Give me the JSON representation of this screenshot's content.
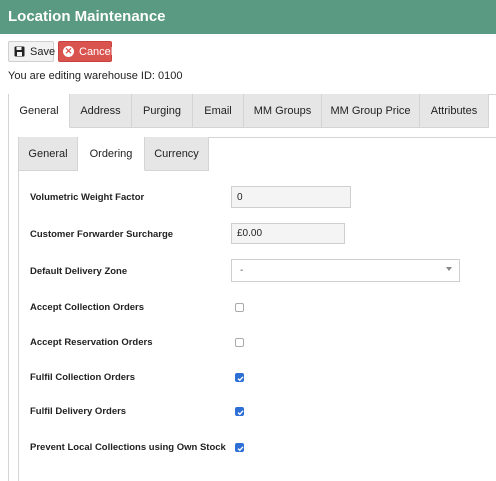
{
  "header": {
    "title": "Location Maintenance"
  },
  "toolbar": {
    "save_label": "Save",
    "save_icon": "floppy-disk-icon",
    "cancel_label": "Cancel",
    "cancel_icon": "close-circle-icon"
  },
  "editing_text": "You are editing warehouse ID: 0100",
  "outer_tabs": [
    {
      "label": "General",
      "active": true
    },
    {
      "label": "Address",
      "active": false
    },
    {
      "label": "Purging",
      "active": false
    },
    {
      "label": "Email",
      "active": false
    },
    {
      "label": "MM Groups",
      "active": false
    },
    {
      "label": "MM Group Price",
      "active": false
    },
    {
      "label": "Attributes",
      "active": false
    }
  ],
  "inner_tabs": [
    {
      "label": "General",
      "active": false
    },
    {
      "label": "Ordering",
      "active": true
    },
    {
      "label": "Currency",
      "active": false
    }
  ],
  "form": {
    "volumetric_weight_factor": {
      "label": "Volumetric Weight Factor",
      "value": "0"
    },
    "customer_forwarder_surcharge": {
      "label": "Customer Forwarder Surcharge",
      "value": "£0.00"
    },
    "default_delivery_zone": {
      "label": "Default Delivery Zone",
      "value": "-"
    },
    "accept_collection_orders": {
      "label": "Accept Collection Orders",
      "checked": false
    },
    "accept_reservation_orders": {
      "label": "Accept Reservation Orders",
      "checked": false
    },
    "fulfil_collection_orders": {
      "label": "Fulfil Collection Orders",
      "checked": true
    },
    "fulfil_delivery_orders": {
      "label": "Fulfil Delivery Orders",
      "checked": true
    },
    "prevent_local_collections": {
      "label": "Prevent Local Collections using Own Stock",
      "checked": true
    }
  },
  "colors": {
    "header": "#5a9a82",
    "cancel": "#d9534f",
    "checkbox": "#2e6fd6"
  }
}
